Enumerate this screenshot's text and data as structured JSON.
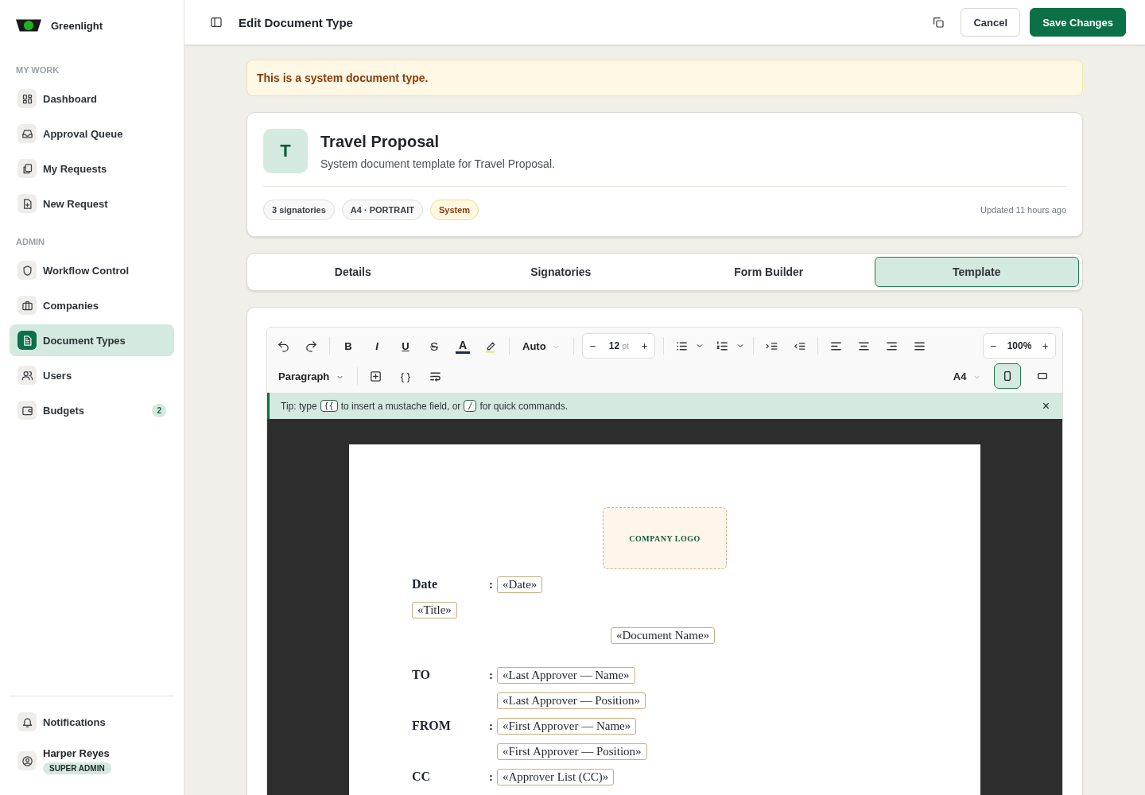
{
  "app": {
    "name": "Greenlight"
  },
  "sidebar": {
    "sections": [
      {
        "heading": "MY WORK",
        "items": [
          {
            "label": "Dashboard",
            "selected": false
          },
          {
            "label": "Approval Queue",
            "selected": false
          },
          {
            "label": "My Requests",
            "selected": false
          },
          {
            "label": "New Request",
            "selected": false
          }
        ]
      },
      {
        "heading": "ADMIN",
        "items": [
          {
            "label": "Workflow Control",
            "selected": false
          },
          {
            "label": "Companies",
            "selected": false
          },
          {
            "label": "Document Types",
            "selected": true
          },
          {
            "label": "Users",
            "selected": false
          },
          {
            "label": "Budgets",
            "selected": false,
            "badge": "2"
          }
        ]
      }
    ],
    "notifications": {
      "label": "Notifications"
    },
    "user": {
      "name": "Harper Reyes",
      "role": "SUPER ADMIN"
    }
  },
  "header": {
    "title": "Edit Document Type",
    "buttons": [
      {
        "kind": "secondary",
        "label": "Cancel"
      },
      {
        "kind": "primary",
        "label": "Save Changes"
      }
    ]
  },
  "notice": "This is a system document type.",
  "doc_type": {
    "initial": "T",
    "name": "Travel Proposal",
    "description": "System document template for Travel Proposal.",
    "tags": [
      {
        "label": "3 signatories",
        "kind": "neutral"
      },
      {
        "label": "A4 · PORTRAIT",
        "kind": "neutral"
      },
      {
        "label": "System",
        "kind": "warning"
      }
    ],
    "updated": "Updated 11 hours ago"
  },
  "tabs": [
    {
      "label": "Details",
      "selected": false
    },
    {
      "label": "Signatories",
      "selected": false
    },
    {
      "label": "Form Builder",
      "selected": false
    },
    {
      "label": "Template",
      "selected": true
    }
  ],
  "editor": {
    "formats": [
      {
        "label": "B",
        "kind": "bold"
      },
      {
        "label": "I",
        "kind": "italic"
      },
      {
        "label": "U",
        "kind": "underline"
      },
      {
        "label": "S",
        "kind": "strike"
      },
      {
        "label": "A",
        "kind": "color"
      }
    ],
    "font": "Auto",
    "font_size": "12",
    "font_unit": "pt",
    "zoom": "100%",
    "block_style": "Paragraph",
    "braces": "{ }",
    "paper": "A4",
    "orientations": [
      {
        "kind": "portrait",
        "selected": true
      },
      {
        "kind": "landscape",
        "selected": false
      }
    ],
    "tip": [
      {
        "kind": "text",
        "text": "Tip: type"
      },
      {
        "kind": "key",
        "text": "{{"
      },
      {
        "kind": "text",
        "text": "to insert a mustache field, or"
      },
      {
        "kind": "key",
        "text": "/"
      },
      {
        "kind": "text",
        "text": "for quick commands."
      }
    ],
    "tip_close": "×",
    "document": {
      "logo": "COMPANY LOGO",
      "lines": [
        {
          "kind": "row",
          "label": "Date",
          "colon": ":",
          "fields": [
            "«Date»"
          ]
        },
        {
          "kind": "field",
          "field": "«Title»"
        },
        {
          "kind": "centered-field",
          "field": "«Document Name»"
        },
        {
          "kind": "row",
          "label": "TO",
          "colon": ":",
          "fields": [
            "«Last Approver — Name»",
            "«Last Approver — Position»"
          ]
        },
        {
          "kind": "row",
          "label": "FROM",
          "colon": ":",
          "fields": [
            "«First Approver — Name»",
            "«First Approver — Position»"
          ]
        },
        {
          "kind": "row",
          "label": "CC",
          "colon": ":",
          "fields": [
            "«Approver List (CC)»"
          ]
        }
      ]
    }
  }
}
